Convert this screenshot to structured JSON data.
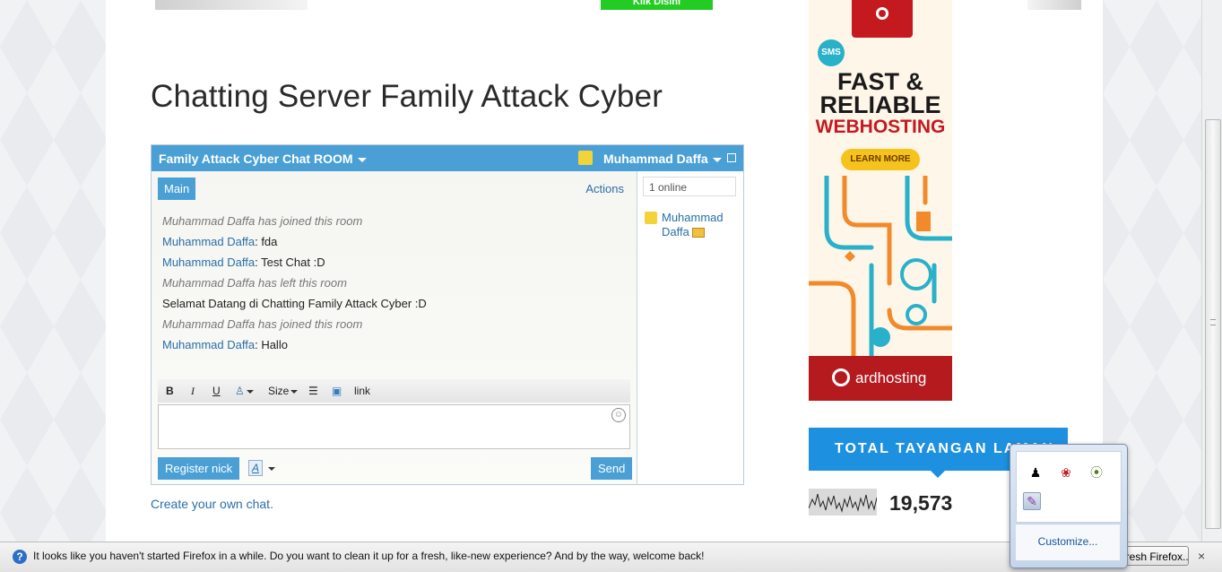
{
  "page": {
    "klik_button": "Klik Disini",
    "post_title": "Chatting Server Family Attack Cyber",
    "create_link": "Create your own chat."
  },
  "chat": {
    "room_title": "Family Attack Cyber Chat ROOM",
    "user_name": "Muhammad Daffa",
    "tab_main": "Main",
    "actions": "Actions",
    "messages": [
      {
        "type": "system",
        "text": "Muhammad Daffa has joined this room"
      },
      {
        "type": "user",
        "author": "Muhammad Daffa",
        "text": ": fda"
      },
      {
        "type": "user",
        "author": "Muhammad Daffa",
        "text": ": Test Chat :D"
      },
      {
        "type": "system",
        "text": "Muhammad Daffa has left this room"
      },
      {
        "type": "plain",
        "text": "Selamat Datang di Chatting Family Attack Cyber :D"
      },
      {
        "type": "system",
        "text": "Muhammad Daffa has joined this room"
      },
      {
        "type": "user",
        "author": "Muhammad Daffa",
        "text": ": Hallo"
      }
    ],
    "toolbar": {
      "bold": "B",
      "italic": "I",
      "underline": "U",
      "size": "Size",
      "link": "link"
    },
    "font_color_label": "A",
    "register_nick": "Register nick",
    "send": "Send",
    "online_count": "1 online",
    "online_user": "Muhammad Daffa"
  },
  "ad": {
    "line1": "FAST &",
    "line2": "RELIABLE",
    "line3": "WEBHOSTING",
    "learn_more": "LEARN MORE",
    "sms_label": "SMS",
    "brand": "ardhosting",
    "colors": {
      "red": "#b51a1e",
      "yellow": "#f6c21c",
      "teal": "#29b1c9",
      "orange": "#f18a2a"
    }
  },
  "stats": {
    "banner": "TOTAL TAYANGAN LAMAN",
    "count": "19,573"
  },
  "notification": {
    "message": "It looks like you haven't started Firefox in a while. Do you want to clean it up for a fresh, like-new experience? And by the way, welcome back!",
    "refresh_button": "Refresh Firefox...",
    "close": "×"
  },
  "tray": {
    "customize": "Customize..."
  }
}
